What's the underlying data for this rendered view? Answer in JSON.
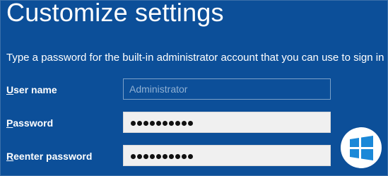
{
  "title": "Customize settings",
  "description": "Type a password for the built-in administrator account that you can use to sign in",
  "fields": {
    "username": {
      "label_prefix": "U",
      "label_rest": "ser name",
      "value": "Administrator"
    },
    "password": {
      "label_prefix": "P",
      "label_rest": "assword",
      "masked_count": 10
    },
    "reenter": {
      "label_prefix": "R",
      "label_rest": "eenter password",
      "masked_count": 10
    }
  },
  "logo": {
    "name": "windows-logo-icon"
  }
}
